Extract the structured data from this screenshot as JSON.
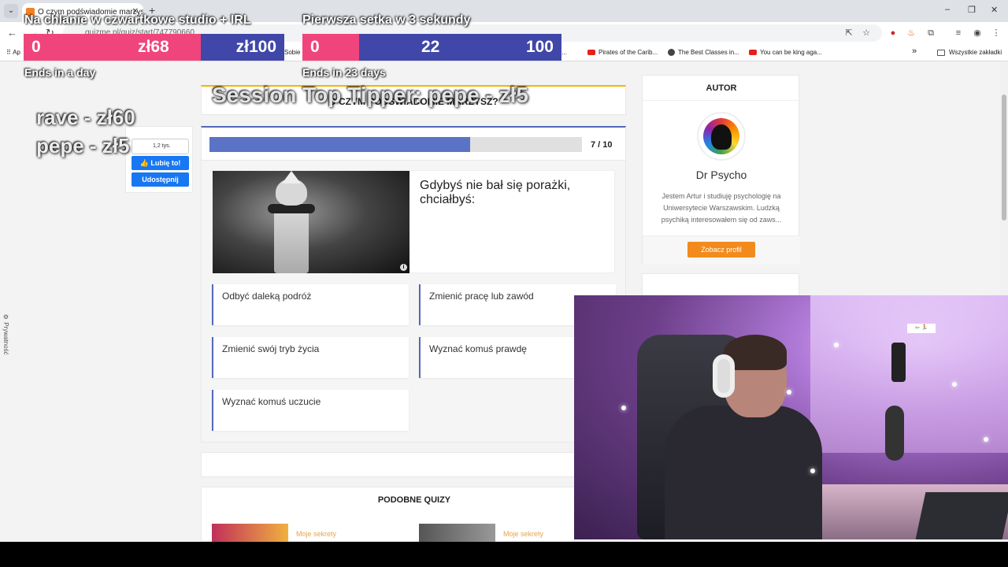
{
  "browser": {
    "tab_title": "O czym podświadomie marzysz?",
    "new_tab": "+",
    "url": "quizme.pl/quiz/start/747790660",
    "window_minimize": "–",
    "window_maximize": "❐",
    "window_close": "✕"
  },
  "bookmarks": {
    "apps_label": "Ap",
    "sobie_label": "Sobie",
    "item_m": "m p...",
    "items": [
      "Pirates of the Carib...",
      "The Best Classes in...",
      "You can be king aga..."
    ],
    "more": "»",
    "all_bookmarks": "Wszystkie zakładki"
  },
  "quiz": {
    "title": "O CZYM PODŚWIADOMIE MARZYSZ?",
    "progress_label": "7 / 10",
    "progress_fraction": 0.7,
    "question": "Gdybyś nie bał się porażki, chciałbyś:",
    "answers": [
      "Odbyć daleką podróż",
      "Zmienić pracę lub zawód",
      "Zmienić swój tryb życia",
      "Wyznać komuś prawdę",
      "Wyznać komuś uczucie"
    ],
    "image_info": "i"
  },
  "social": {
    "like_count": "1,2 tys.",
    "like_button": "Lubię to!",
    "share_button": "Udostępnij"
  },
  "similar": {
    "title": "PODOBNE QUIZY",
    "items": [
      {
        "category": "Moje sekrety"
      },
      {
        "category": "Moje sekrety"
      }
    ]
  },
  "author": {
    "header": "AUTOR",
    "name": "Dr Psycho",
    "bio": "Jestem Artur i studiuję psychologię na Uniwersytecie Warszawskim. Ludzką psychiką interesowałem się od zaws...",
    "profile_button": "Zobacz profil"
  },
  "privacy": "Prywatność",
  "overlay": {
    "goal1": {
      "title": "Na chlanie w czwartkowe studio + IRL",
      "start": "0",
      "current": "zł68",
      "target": "zł100",
      "ends": "Ends in a day",
      "fraction": 0.68
    },
    "goal2": {
      "title": "Pierwsza setka w 3 sekundy",
      "start": "0",
      "current": "22",
      "target": "100",
      "ends": "Ends in 23 days",
      "fraction": 0.22
    },
    "top_tipper": "Session Top Tipper: pepe - zł5",
    "tips": [
      "rave - zł60",
      "pepe - zł5"
    ]
  },
  "webcam": {
    "sign_text": "⇦ 🏃"
  },
  "colors": {
    "goal_pink": "#f0457c",
    "goal_blue": "#4047a8",
    "progress": "#5b73c6",
    "profile_button": "#f28b1c",
    "facebook": "#1877f2"
  }
}
